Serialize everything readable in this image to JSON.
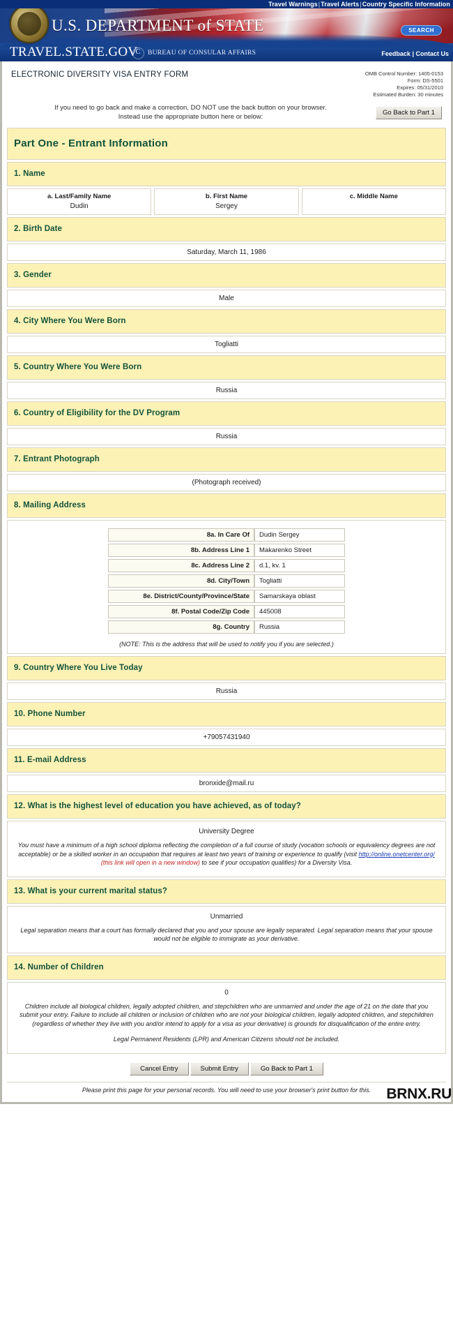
{
  "banner": {
    "top_nav": [
      "Travel Warnings",
      "Travel Alerts",
      "Country Specific Information"
    ],
    "department": "U.S. DEPARTMENT of STATE",
    "department_main": "U.S. D",
    "site": "TRAVEL.STATE.GOV",
    "bureau": "BUREAU OF CONSULAR AFFAIRS",
    "search_label": "SEARCH",
    "feedback": "Feedback",
    "contact": "Contact Us",
    "separator": "|"
  },
  "header": {
    "form_title": "ELECTRONIC DIVERSITY VISA ENTRY FORM",
    "omb_control": "OMB Control Number: 1405-0153",
    "form_number": "Form: DS-5501",
    "expires": "Expires: 05/31/2010",
    "burden": "Estimated Burden: 30 minutes",
    "instruction_line1": "If you need to go back and make a correction, DO NOT use the back button on your browser.",
    "instruction_line2": "Instead use the appropriate button here or below:",
    "go_back_label": "Go Back to Part 1"
  },
  "part": {
    "title": "Part One - Entrant Information"
  },
  "questions": {
    "q1": {
      "label": "1. Name",
      "fields": [
        {
          "label": "a. Last/Family Name",
          "value": "Dudin"
        },
        {
          "label": "b. First Name",
          "value": "Sergey"
        },
        {
          "label": "c. Middle Name",
          "value": ""
        }
      ]
    },
    "q2": {
      "label": "2. Birth Date",
      "value": "Saturday, March 11, 1986"
    },
    "q3": {
      "label": "3. Gender",
      "value": "Male"
    },
    "q4": {
      "label": "4. City Where You Were Born",
      "value": "Togliatti"
    },
    "q5": {
      "label": "5. Country Where You Were Born",
      "value": "Russia"
    },
    "q6": {
      "label": "6. Country of Eligibility for the DV Program",
      "value": "Russia"
    },
    "q7": {
      "label": "7. Entrant Photograph",
      "value": "(Photograph received)"
    },
    "q8": {
      "label": "8. Mailing Address",
      "rows": [
        {
          "label": "8a. In Care Of",
          "value": "Dudin Sergey"
        },
        {
          "label": "8b. Address Line 1",
          "value": "Makarenko Street"
        },
        {
          "label": "8c. Address Line 2",
          "value": "d.1, kv. 1"
        },
        {
          "label": "8d. City/Town",
          "value": "Togliatti"
        },
        {
          "label": "8e. District/County/Province/State",
          "value": "Samarskaya oblast"
        },
        {
          "label": "8f. Postal Code/Zip Code",
          "value": "445008"
        },
        {
          "label": "8g. Country",
          "value": "Russia"
        }
      ],
      "note": "(NOTE: This is the address that will be used to notify you if you are selected.)"
    },
    "q9": {
      "label": "9. Country Where You Live Today",
      "value": "Russia"
    },
    "q10": {
      "label": "10. Phone Number",
      "value": "+79057431940"
    },
    "q11": {
      "label": "11. E-mail Address",
      "value": "bronxide@mail.ru"
    },
    "q12": {
      "label": "12. What is the highest level of education you have achieved, as of today?",
      "value": "University Degree",
      "note_part1": "You must have a minimum of a high school diploma reflecting the completion of a full course of study (vocation schools or equivalency degrees are not acceptable) or be a skilled worker in an occupation that requires at least two years of training or experience to qualify (visit ",
      "note_link": "http://online.onetcenter.org/",
      "note_red": "(this link will open in a new window)",
      "note_part2": " to see if your occupation qualifies) for a Diversity Visa."
    },
    "q13": {
      "label": "13. What is your current marital status?",
      "value": "Unmarried",
      "note": "Legal separation means that a court has formally declared that you and your spouse are legally separated. Legal separation means that your spouse would not be eligible to immigrate as your derivative."
    },
    "q14": {
      "label": "14. Number of Children",
      "value": "0",
      "note1": "Children include all biological children, legally adopted children, and stepchildren who are unmarried and under the age of 21 on the date that you submit your entry. Failure to include all children or inclusion of children who are not your biological children, legally adopted children, and stepchildren (regardless of whether they live with you and/or intend to apply for a visa as your derivative) is grounds for disqualification of the entire entry.",
      "note2": "Legal Permanent Residents (LPR) and American Citizens should not be included."
    }
  },
  "footer": {
    "cancel_label": "Cancel Entry",
    "submit_label": "Submit Entry",
    "goback_label": "Go Back to Part 1",
    "print_note": "Please print this page for your personal records. You will need to use your browser's print button for this.",
    "watermark": "BRNX.RU"
  }
}
